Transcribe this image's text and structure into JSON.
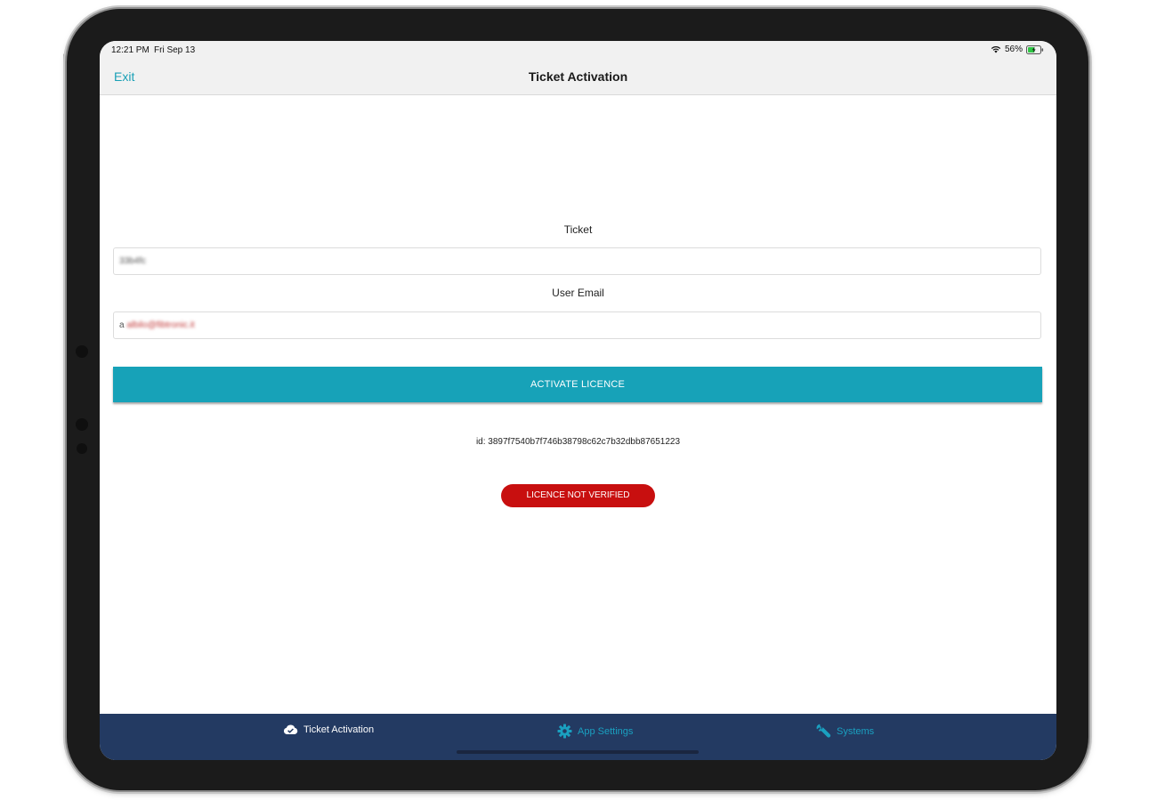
{
  "status_bar": {
    "time": "12:21 PM",
    "date": "Fri Sep 13",
    "battery": "56%",
    "icons": [
      "wifi-icon",
      "battery-charging-icon"
    ]
  },
  "nav": {
    "exit_label": "Exit",
    "title": "Ticket Activation"
  },
  "form": {
    "ticket_label": "Ticket",
    "ticket_value": "33b4fc",
    "email_label": "User Email",
    "email_value_prefix": "a",
    "email_value_blurred": "albilo@fibtronic.it",
    "activate_label": "ACTIVATE LICENCE"
  },
  "device_id": "id: 3897f7540b7f746b38798c62c7b32dbb87651223",
  "licence_status": {
    "label": "LICENCE NOT VERIFIED",
    "color": "#c80f0f"
  },
  "tabs": [
    {
      "label": "Ticket Activation",
      "icon": "cloud-check-icon",
      "active": true
    },
    {
      "label": "App Settings",
      "icon": "gear-icon",
      "active": false
    },
    {
      "label": "Systems",
      "icon": "wrench-icon",
      "active": false
    }
  ],
  "colors": {
    "accent": "#17a2b8",
    "tab_bar": "#233a62",
    "tab_inactive": "#1aa0c0",
    "error": "#c80f0f"
  }
}
